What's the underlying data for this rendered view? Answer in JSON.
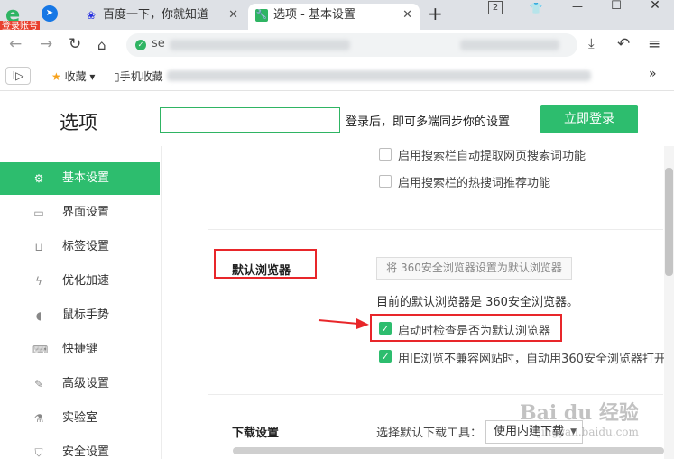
{
  "browser": {
    "account_badge": "登录账号",
    "tabs": [
      {
        "title": "百度一下，你就知道",
        "icon": "baidu-paw-icon"
      },
      {
        "title": "选项 - 基本设置",
        "icon": "wrench-icon"
      }
    ],
    "new_tab_label": "+",
    "tab_count": "2",
    "url_prefix": "se",
    "bookmarks": {
      "favorites_label": "收藏",
      "mobile_label": "手机收藏"
    }
  },
  "header": {
    "title": "选项",
    "search_value": "",
    "sync_text": "登录后，即可多端同步你的设置",
    "login_button": "立即登录"
  },
  "sidebar": {
    "items": [
      {
        "label": "基本设置",
        "icon": "settings-icon",
        "active": true
      },
      {
        "label": "界面设置",
        "icon": "window-icon"
      },
      {
        "label": "标签设置",
        "icon": "tab-icon"
      },
      {
        "label": "优化加速",
        "icon": "lightning-icon"
      },
      {
        "label": "鼠标手势",
        "icon": "mouse-icon"
      },
      {
        "label": "快捷键",
        "icon": "keyboard-icon"
      },
      {
        "label": "高级设置",
        "icon": "wrench-icon"
      },
      {
        "label": "实验室",
        "icon": "flask-icon"
      },
      {
        "label": "安全设置",
        "icon": "shield-icon"
      }
    ]
  },
  "content": {
    "search_options": [
      {
        "label": "启用搜索栏自动提取网页搜索词功能",
        "checked": false
      },
      {
        "label": "启用搜索栏的热搜词推荐功能",
        "checked": false
      }
    ],
    "default_browser": {
      "section_label": "默认浏览器",
      "set_default_button": "将 360安全浏览器设置为默认浏览器",
      "current_status": "目前的默认浏览器是 360安全浏览器。",
      "options": [
        {
          "label": "启动时检查是否为默认浏览器",
          "checked": true
        },
        {
          "label": "用IE浏览不兼容网站时，自动用360安全浏览器打开",
          "checked": true
        }
      ]
    },
    "download": {
      "section_label": "下载设置",
      "tool_label": "选择默认下载工具：",
      "tool_value": "使用内建下载"
    }
  },
  "watermark": {
    "text": "Bai du 经验",
    "sub": "jingyan.baidu.com"
  },
  "colors": {
    "accent": "#2dbd6e",
    "highlight": "#e8262a"
  }
}
